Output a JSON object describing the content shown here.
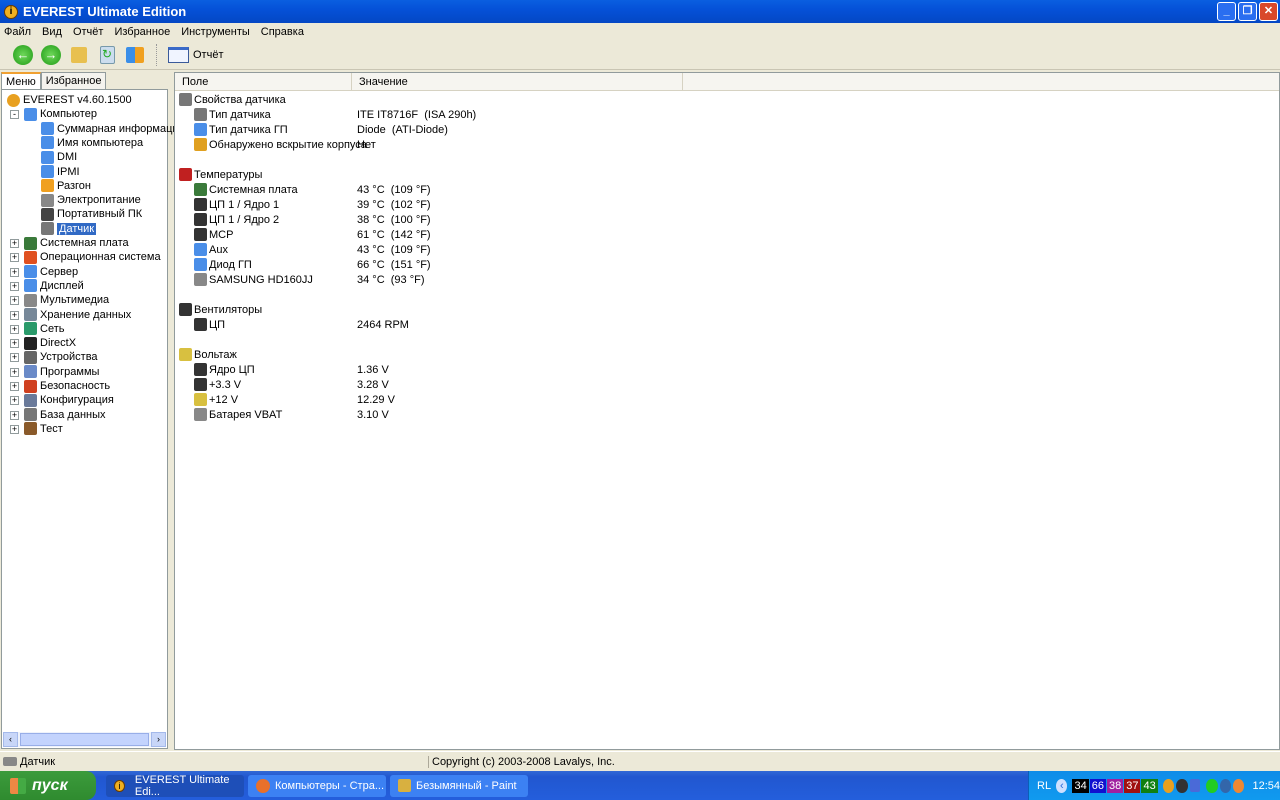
{
  "window": {
    "title": "EVEREST Ultimate Edition",
    "minimize": "_",
    "maximize": "❐",
    "close": "✕"
  },
  "menu": [
    "Файл",
    "Вид",
    "Отчёт",
    "Избранное",
    "Инструменты",
    "Справка"
  ],
  "toolbar": {
    "report_label": "Отчёт"
  },
  "tabs": [
    "Меню",
    "Избранное"
  ],
  "tree": [
    {
      "label": "EVEREST v4.60.1500",
      "level": 0,
      "icon": "info",
      "color": "#e8a020"
    },
    {
      "label": "Компьютер",
      "level": 1,
      "icon": "computer",
      "color": "#4a8ee8",
      "exp": "-"
    },
    {
      "label": "Суммарная информация",
      "level": 2,
      "icon": "computer",
      "color": "#4a8ee8"
    },
    {
      "label": "Имя компьютера",
      "level": 2,
      "icon": "computer",
      "color": "#4a8ee8"
    },
    {
      "label": "DMI",
      "level": 2,
      "icon": "computer",
      "color": "#4a8ee8"
    },
    {
      "label": "IPMI",
      "level": 2,
      "icon": "computer",
      "color": "#4a8ee8"
    },
    {
      "label": "Разгон",
      "level": 2,
      "icon": "flame",
      "color": "#f0a020"
    },
    {
      "label": "Электропитание",
      "level": 2,
      "icon": "power",
      "color": "#888888"
    },
    {
      "label": "Портативный ПК",
      "level": 2,
      "icon": "laptop",
      "color": "#444444"
    },
    {
      "label": "Датчик",
      "level": 2,
      "icon": "sensor",
      "color": "#777777",
      "selected": true
    },
    {
      "label": "Системная плата",
      "level": 1,
      "icon": "motherboard",
      "color": "#3a7a3a",
      "exp": "+"
    },
    {
      "label": "Операционная система",
      "level": 1,
      "icon": "windows",
      "color": "#e05020",
      "exp": "+"
    },
    {
      "label": "Сервер",
      "level": 1,
      "icon": "server",
      "color": "#4a8ee8",
      "exp": "+"
    },
    {
      "label": "Дисплей",
      "level": 1,
      "icon": "display",
      "color": "#4a8ee8",
      "exp": "+"
    },
    {
      "label": "Мультимедиа",
      "level": 1,
      "icon": "multimedia",
      "color": "#888888",
      "exp": "+"
    },
    {
      "label": "Хранение данных",
      "level": 1,
      "icon": "storage",
      "color": "#778899",
      "exp": "+"
    },
    {
      "label": "Сеть",
      "level": 1,
      "icon": "network",
      "color": "#2a9a6a",
      "exp": "+"
    },
    {
      "label": "DirectX",
      "level": 1,
      "icon": "directx",
      "color": "#222222",
      "exp": "+"
    },
    {
      "label": "Устройства",
      "level": 1,
      "icon": "devices",
      "color": "#666666",
      "exp": "+"
    },
    {
      "label": "Программы",
      "level": 1,
      "icon": "programs",
      "color": "#6a8ac8",
      "exp": "+"
    },
    {
      "label": "Безопасность",
      "level": 1,
      "icon": "shield",
      "color": "#d04020",
      "exp": "+"
    },
    {
      "label": "Конфигурация",
      "level": 1,
      "icon": "config",
      "color": "#6a7a9a",
      "exp": "+"
    },
    {
      "label": "База данных",
      "level": 1,
      "icon": "database",
      "color": "#777777",
      "exp": "+"
    },
    {
      "label": "Тест",
      "level": 1,
      "icon": "hourglass",
      "color": "#8a5a2a",
      "exp": "+"
    }
  ],
  "columns": [
    "Поле",
    "Значение"
  ],
  "rows": [
    {
      "field": "Свойства датчика",
      "value": "",
      "group": true,
      "icon": "sensor",
      "color": "#777777"
    },
    {
      "field": "Тип датчика",
      "value": "ITE IT8716F  (ISA 290h)",
      "icon": "sensor",
      "color": "#777777"
    },
    {
      "field": "Тип датчика ГП",
      "value": "Diode  (ATI-Diode)",
      "icon": "display",
      "color": "#4a8ee8"
    },
    {
      "field": "Обнаружено вскрытие корпуса",
      "value": "Нет",
      "icon": "lock",
      "color": "#e0a020"
    },
    {
      "blank": true
    },
    {
      "field": "Температуры",
      "value": "",
      "group": true,
      "icon": "thermometer",
      "color": "#c02020"
    },
    {
      "field": "Системная плата",
      "value": "43 °C  (109 °F)",
      "icon": "motherboard",
      "color": "#3a7a3a"
    },
    {
      "field": "ЦП 1 / Ядро 1",
      "value": "39 °C  (102 °F)",
      "icon": "cpu",
      "color": "#333333"
    },
    {
      "field": "ЦП 1 / Ядро 2",
      "value": "38 °C  (100 °F)",
      "icon": "cpu",
      "color": "#333333"
    },
    {
      "field": "MCP",
      "value": "61 °C  (142 °F)",
      "icon": "cpu",
      "color": "#333333"
    },
    {
      "field": "Aux",
      "value": "43 °C  (109 °F)",
      "icon": "display",
      "color": "#4a8ee8"
    },
    {
      "field": "Диод ГП",
      "value": "66 °C  (151 °F)",
      "icon": "display",
      "color": "#4a8ee8"
    },
    {
      "field": "SAMSUNG HD160JJ",
      "value": "34 °C  (93 °F)",
      "icon": "disk",
      "color": "#888888"
    },
    {
      "blank": true
    },
    {
      "field": "Вентиляторы",
      "value": "",
      "group": true,
      "icon": "fan",
      "color": "#333333"
    },
    {
      "field": "ЦП",
      "value": "2464 RPM",
      "icon": "cpu",
      "color": "#333333"
    },
    {
      "blank": true
    },
    {
      "field": "Вольтаж",
      "value": "",
      "group": true,
      "icon": "warning",
      "color": "#d8c040"
    },
    {
      "field": "Ядро ЦП",
      "value": "1.36 V",
      "icon": "cpu",
      "color": "#333333"
    },
    {
      "field": "+3.3 V",
      "value": "3.28 V",
      "icon": "cpu",
      "color": "#333333"
    },
    {
      "field": "+12 V",
      "value": "12.29 V",
      "icon": "warning",
      "color": "#d8c040"
    },
    {
      "field": "Батарея VBAT",
      "value": "3.10 V",
      "icon": "battery",
      "color": "#888888"
    }
  ],
  "status": {
    "left": "Датчик",
    "right": "Copyright (c) 2003-2008 Lavalys, Inc."
  },
  "taskbar": {
    "start": "пуск",
    "tasks": [
      "EVEREST Ultimate Edi...",
      "Компьютеры - Стра...",
      "Безымянный - Paint"
    ],
    "lang": "RL",
    "temps": [
      {
        "v": "34",
        "c": "#000000"
      },
      {
        "v": "66",
        "c": "#1010d0"
      },
      {
        "v": "38",
        "c": "#a020a0"
      },
      {
        "v": "37",
        "c": "#a01010"
      },
      {
        "v": "43",
        "c": "#108010"
      }
    ],
    "clock": "12:54"
  }
}
